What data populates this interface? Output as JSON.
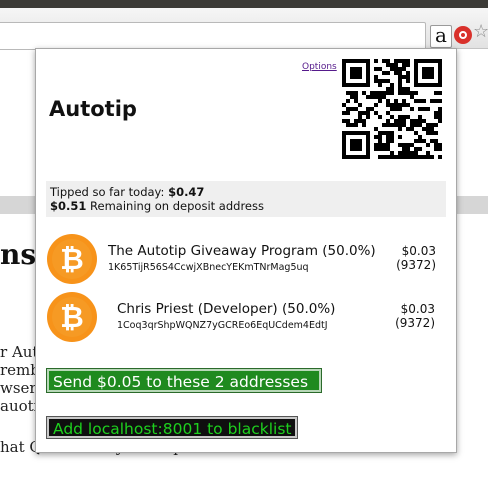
{
  "browser": {
    "extension_label": "a"
  },
  "popup": {
    "options_label": "Options",
    "title": "Autotip",
    "stats": {
      "tipped_label": "Tipped so far today:",
      "tipped_value": "$0.47",
      "remaining_value": "$0.51",
      "remaining_label": "Remaining on deposit address"
    },
    "payees": [
      {
        "name": "The Autotip Giveaway Program (50.0%)",
        "address": "1K65TijR56S4CcwjXBnecYEKmTNrMag5uq",
        "amount": "$0.03",
        "count": "(9372)"
      },
      {
        "name": "Chris Priest (Developer) (50.0%)",
        "address": "1Coq3qrShpWQNZ7yGCREo6EqUCdem4EdtJ",
        "amount": "$0.03",
        "count": "(9372)"
      }
    ],
    "send_label": "Send $0.05 to these 2 addresses",
    "blacklist_label": "Add localhost:8001 to blacklist"
  },
  "background_page": {
    "heading_fragment": "ns",
    "lines": [
      "r Auto",
      "rembe",
      "wser's",
      "auoti"
    ],
    "last_line": "hat QR code is your deposit address. You must send some"
  },
  "colors": {
    "send_button": "#1f8a1f",
    "blacklist_button": "#0f0f0f",
    "blacklist_text": "#1ed01e",
    "bitcoin_orange": "#f7931a"
  },
  "icons": [
    "autotip-extension-icon",
    "red-extension-icon",
    "bookmark-star-icon",
    "qr-code",
    "bitcoin-icon"
  ]
}
